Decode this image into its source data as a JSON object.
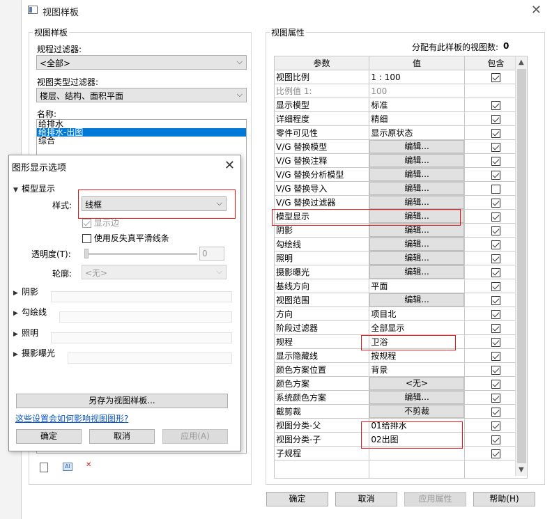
{
  "main": {
    "title": "视图样板",
    "left_group_label": "视图样板",
    "discipline_filter_label": "规程过滤器:",
    "discipline_filter_value": "<全部>",
    "view_type_filter_label": "视图类型过滤器:",
    "view_type_filter_value": "楼层、结构、面积平面",
    "names_label": "名称:",
    "names": [
      "给排水",
      "给排水-出图",
      "综合"
    ],
    "selected_name_index": 1,
    "right_group_label": "视图属性",
    "assigned_count_label": "分配有此样板的视图数:",
    "assigned_count": "0",
    "table_headers": [
      "参数",
      "值",
      "包含"
    ],
    "rows": [
      {
        "param": "视图比例",
        "value": "1 : 100",
        "type": "text",
        "include": true
      },
      {
        "param": "比例值 1:",
        "value": "100",
        "type": "gray",
        "include": null
      },
      {
        "param": "显示模型",
        "value": "标准",
        "type": "text",
        "include": true
      },
      {
        "param": "详细程度",
        "value": "精细",
        "type": "text",
        "include": true
      },
      {
        "param": "零件可见性",
        "value": "显示原状态",
        "type": "text",
        "include": true
      },
      {
        "param": "V/G 替换模型",
        "value": "编辑...",
        "type": "button",
        "include": true
      },
      {
        "param": "V/G 替换注释",
        "value": "编辑...",
        "type": "button",
        "include": true
      },
      {
        "param": "V/G 替换分析模型",
        "value": "编辑...",
        "type": "button",
        "include": true
      },
      {
        "param": "V/G 替换导入",
        "value": "编辑...",
        "type": "button",
        "include": false
      },
      {
        "param": "V/G 替换过滤器",
        "value": "编辑...",
        "type": "button",
        "include": true
      },
      {
        "param": "模型显示",
        "value": "编辑...",
        "type": "button",
        "include": true
      },
      {
        "param": "阴影",
        "value": "编辑...",
        "type": "button",
        "include": true
      },
      {
        "param": "勾绘线",
        "value": "编辑...",
        "type": "button",
        "include": true
      },
      {
        "param": "照明",
        "value": "编辑...",
        "type": "button",
        "include": true
      },
      {
        "param": "摄影曝光",
        "value": "编辑...",
        "type": "button",
        "include": true
      },
      {
        "param": "基线方向",
        "value": "平面",
        "type": "text",
        "include": true
      },
      {
        "param": "视图范围",
        "value": "编辑...",
        "type": "button",
        "include": true
      },
      {
        "param": "方向",
        "value": "项目北",
        "type": "text",
        "include": true
      },
      {
        "param": "阶段过滤器",
        "value": "全部显示",
        "type": "text",
        "include": true
      },
      {
        "param": "规程",
        "value": "卫浴",
        "type": "text",
        "include": true
      },
      {
        "param": "显示隐藏线",
        "value": "按规程",
        "type": "text",
        "include": true
      },
      {
        "param": "颜色方案位置",
        "value": "背景",
        "type": "text",
        "include": true
      },
      {
        "param": "颜色方案",
        "value": "<无>",
        "type": "button",
        "include": true
      },
      {
        "param": "系统颜色方案",
        "value": "编辑...",
        "type": "button",
        "include": true
      },
      {
        "param": "截剪裁",
        "value": "不剪裁",
        "type": "button",
        "include": true
      },
      {
        "param": "视图分类-父",
        "value": "01给排水",
        "type": "text",
        "include": true
      },
      {
        "param": "视图分类-子",
        "value": "02出图",
        "type": "text",
        "include": true
      },
      {
        "param": "子规程",
        "value": "",
        "type": "text",
        "include": true
      }
    ],
    "footer_buttons": {
      "ok": "确定",
      "cancel": "取消",
      "apply": "应用属性",
      "help": "帮助(H)"
    }
  },
  "dialog": {
    "title": "图形显示选项",
    "model_display": "模型显示",
    "style_label": "样式:",
    "style_value": "线框",
    "show_edges": "显示边",
    "antialias": "使用反失真平滑线条",
    "transparency_label": "透明度(T):",
    "transparency_value": "0",
    "silhouette_label": "轮廓:",
    "silhouette_value": "<无>",
    "sections": [
      "阴影",
      "勾绘线",
      "照明",
      "摄影曝光"
    ],
    "save_template": "另存为视图样板...",
    "help_link": "这些设置会如何影响视图图形?",
    "ok": "确定",
    "cancel": "取消",
    "apply": "应用(A)"
  }
}
